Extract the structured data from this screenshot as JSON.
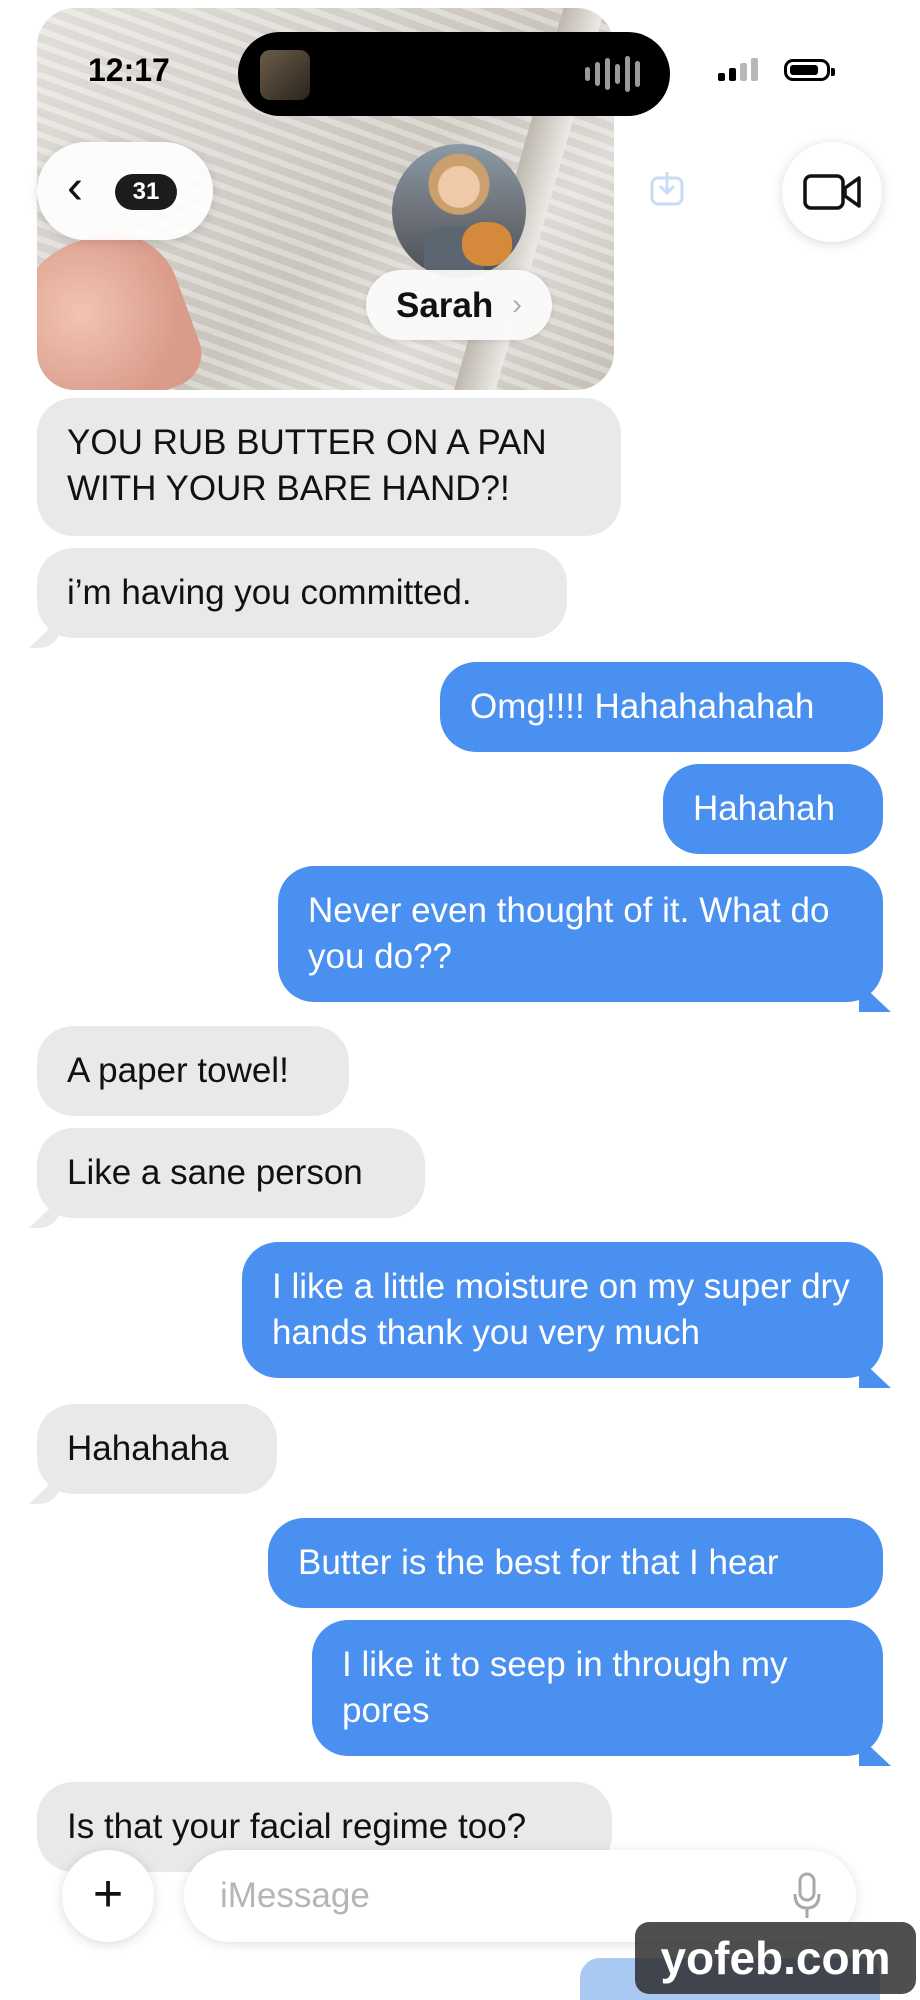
{
  "status_bar": {
    "time": "12:17"
  },
  "header": {
    "back_count": "31",
    "contact_name": "Sarah"
  },
  "messages": [
    {
      "from": "them",
      "text": "YOU RUB BUTTER ON A PAN WITH YOUR BARE HAND?!"
    },
    {
      "from": "them",
      "text": "i’m having you committed."
    },
    {
      "from": "me",
      "text": "Omg!!!! Hahahahahah"
    },
    {
      "from": "me",
      "text": "Hahahah"
    },
    {
      "from": "me",
      "text": "Never even thought of it. What do you do??"
    },
    {
      "from": "them",
      "text": "A paper towel!"
    },
    {
      "from": "them",
      "text": "Like a sane person"
    },
    {
      "from": "me",
      "text": "I like a little moisture on my super dry hands thank you very much"
    },
    {
      "from": "them",
      "text": "Hahahaha"
    },
    {
      "from": "me",
      "text": "Butter is the best for that I hear"
    },
    {
      "from": "me",
      "text": "I like it to seep in through my pores"
    },
    {
      "from": "them",
      "text": "Is that your facial regime too?"
    }
  ],
  "composer": {
    "placeholder": "iMessage"
  },
  "watermark": "yofeb.com",
  "colors": {
    "outgoing": "#4a90f0",
    "incoming": "#e9e9eb"
  },
  "icons": [
    "back-chevron-icon",
    "video-camera-icon",
    "download-icon",
    "plus-icon",
    "microphone-icon",
    "signal-icon",
    "battery-icon"
  ]
}
